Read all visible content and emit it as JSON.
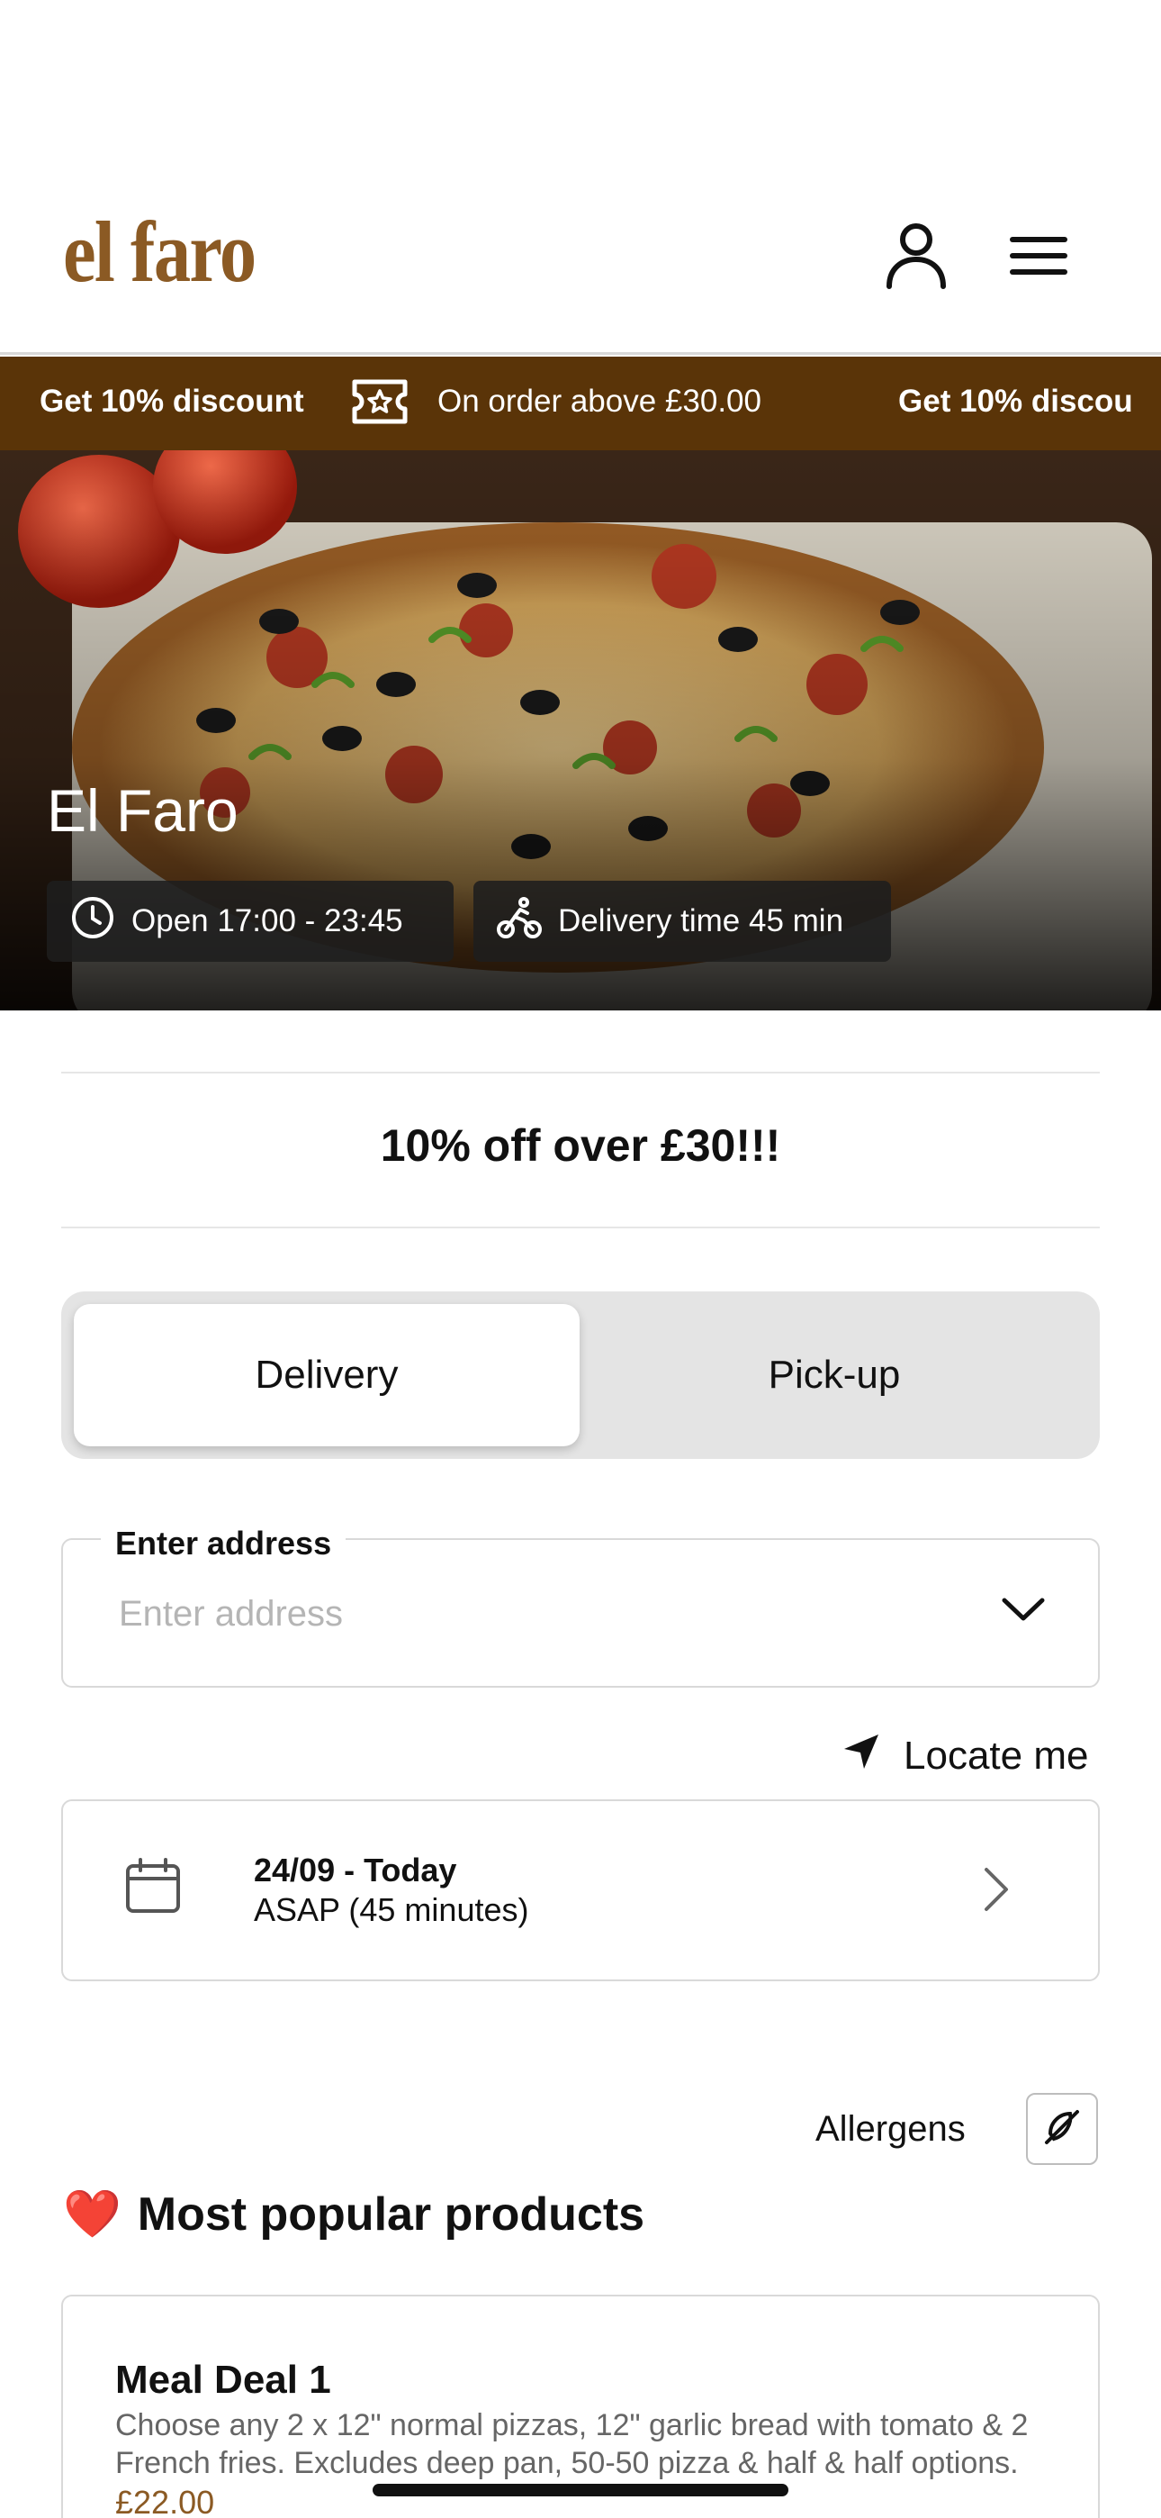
{
  "header": {
    "logo_text": "el faro",
    "icons": [
      "user-icon",
      "menu-icon"
    ]
  },
  "promo_banner": {
    "discount_label": "Get 10% discount",
    "condition_label": "On order above £30.00",
    "repeat_label": "Get 10% discou",
    "icon": "ticket-icon"
  },
  "hero": {
    "restaurant_name": "El Faro",
    "opening_hours": "Open 17:00 - 23:45",
    "delivery_time": "Delivery time 45 min",
    "icons": [
      "clock-icon",
      "bike-icon"
    ]
  },
  "offer": {
    "text": "10% off over £30!!!"
  },
  "order_mode": {
    "options": [
      "Delivery",
      "Pick-up"
    ],
    "selected": "Delivery"
  },
  "address": {
    "label": "Enter address",
    "placeholder": "Enter address",
    "value": ""
  },
  "locate": {
    "label": "Locate me"
  },
  "schedule": {
    "date": "24/09 - Today",
    "time": "ASAP (45 minutes)"
  },
  "allergens": {
    "label": "Allergens"
  },
  "popular": {
    "title": "Most popular products",
    "emoji": "❤️",
    "products": [
      {
        "name": "Meal Deal 1",
        "description": "Choose any 2 x 12\" normal pizzas, 12\" garlic bread with tomato & 2 French fries. Excludes deep pan, 50-50 pizza & half & half options.",
        "price": "£22.00"
      }
    ]
  },
  "colors": {
    "brand": "#8b5a24",
    "promo_bg": "#5a3408",
    "toggle_bg": "#e4e4e4"
  }
}
